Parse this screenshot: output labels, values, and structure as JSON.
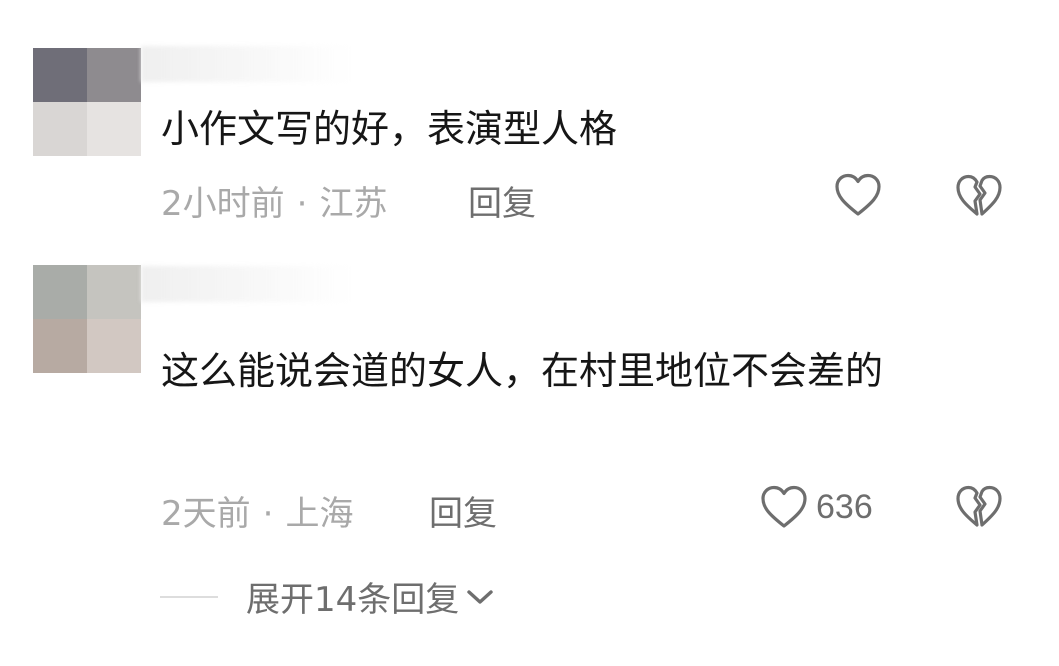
{
  "comments": [
    {
      "text": "小作文写的好，表演型人格",
      "time": "2小时前",
      "separator": "·",
      "location": "江苏",
      "reply_label": "回复",
      "like_count": "",
      "like_icon": "heart-outline-icon",
      "dislike_icon": "broken-heart-icon"
    },
    {
      "text": "这么能说会道的女人，在村里地位不会差的",
      "time": "2天前",
      "separator": "·",
      "location": "上海",
      "reply_label": "回复",
      "like_count": "636",
      "like_icon": "heart-outline-icon",
      "dislike_icon": "broken-heart-icon"
    }
  ],
  "expand_replies": {
    "label": "展开14条回复",
    "icon": "chevron-down-icon"
  },
  "colors": {
    "text": "#161616",
    "meta": "#a9a9a9",
    "action": "#6e6e6e",
    "background": "#ffffff"
  }
}
